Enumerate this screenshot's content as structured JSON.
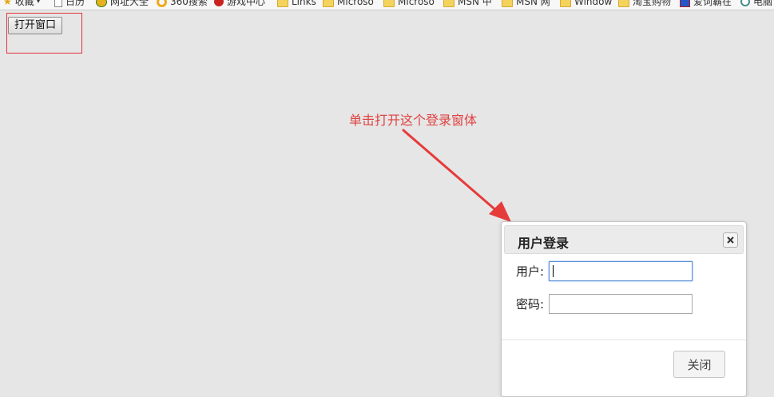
{
  "bookmarks": {
    "items": [
      {
        "label": "收藏",
        "icon": "star-icon"
      },
      {
        "label": "日历",
        "icon": "page-icon"
      },
      {
        "label": "网址大全",
        "icon": "globe-icon"
      },
      {
        "label": "360搜索",
        "icon": "ring-icon"
      },
      {
        "label": "游戏中心",
        "icon": "game-icon"
      },
      {
        "label": "Links",
        "icon": "folder-icon"
      },
      {
        "label": "Microso",
        "icon": "folder-icon"
      },
      {
        "label": "Microso",
        "icon": "folder-icon"
      },
      {
        "label": "MSN 中",
        "icon": "folder-icon"
      },
      {
        "label": "MSN 网",
        "icon": "folder-icon"
      },
      {
        "label": "Window",
        "icon": "folder-icon"
      },
      {
        "label": "淘宝购物",
        "icon": "folder-icon"
      },
      {
        "label": "爱词霸在",
        "icon": "dictionary-icon"
      },
      {
        "label": "电脑",
        "icon": "computer-icon"
      }
    ]
  },
  "open_button": {
    "label": "打开窗口"
  },
  "annotation": {
    "text": "单击打开这个登录窗体",
    "color": "#e04141"
  },
  "dialog": {
    "title": "用户登录",
    "close_icon": "close-icon",
    "user_label": "用户:",
    "pass_label": "密码:",
    "user_value": "",
    "pass_value": "",
    "close_button_label": "关闭"
  },
  "colors": {
    "page_background": "#e6e6e6",
    "highlight_border": "#e0333a",
    "focus_border": "#5c8fd6"
  }
}
